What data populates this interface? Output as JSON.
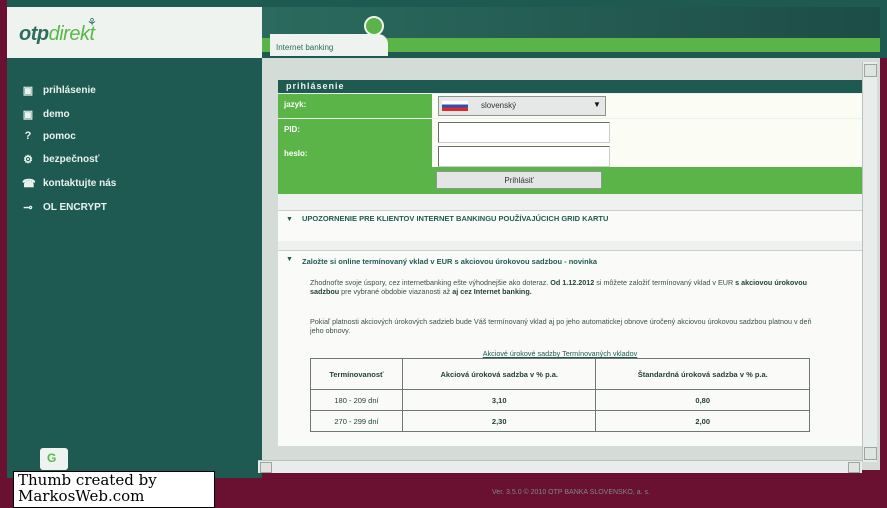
{
  "brand": {
    "logo_main": "otp",
    "logo_accent": "direkt"
  },
  "header": {
    "tab_label": "Internet banking"
  },
  "sidebar": {
    "items": [
      {
        "label": "prihlásenie",
        "icon": "square-icon"
      },
      {
        "label": "demo",
        "icon": "square-icon"
      },
      {
        "label": "pomoc",
        "icon": "question-icon"
      },
      {
        "label": "bezpečnosť",
        "icon": "gear-icon"
      },
      {
        "label": "kontaktujte nás",
        "icon": "phone-icon"
      },
      {
        "label": "OL ENCRYPT",
        "icon": "key-icon"
      }
    ]
  },
  "login": {
    "title": "prihlásenie",
    "language_label": "jazyk:",
    "language_value": "slovenský",
    "pid_label": "PID:",
    "password_label": "heslo:",
    "submit_label": "Prihlásiť"
  },
  "notice1": {
    "title": "UPOZORNENIE PRE KLIENTOV INTERNET BANKINGU POUŽÍVAJÚCICH GRID KARTU"
  },
  "notice2": {
    "title": "Založte si online termínovaný vklad v EUR s akciovou úrokovou sadzbou - novinka",
    "para1_a": "Zhodnoťte svoje úspory, cez internetbanking ešte výhodnejšie ako doteraz. ",
    "para1_b": "Od 1.12.2012",
    "para1_c": " si môžete založiť termínovaný vklad v EUR ",
    "para1_d": "s akciovou úrokovou sadzbou",
    "para1_e": " pre vybrané obdobie viazanosti až ",
    "para1_f": "aj cez Internet banking.",
    "para2": "Pokiaľ platnosti akciových úrokových sadzieb bude Váš termínovaný vklad aj po jeho automatickej obnove úročený akciovou úrokovou sadzbou platnou v deň jeho obnovy.",
    "table_caption": "Akciové úrokové sadzby Termínovaných vkladov",
    "headers": [
      "Termínovanosť",
      "Akciová úroková sadzba v % p.a.",
      "Štandardná úroková sadzba v % p.a."
    ],
    "rows": [
      [
        "180 - 209 dní",
        "3,10",
        "0,80"
      ],
      [
        "270 - 299 dní",
        "2,30",
        "2,00"
      ]
    ]
  },
  "footer": {
    "text": "Ver. 3.5.0 © 2010 OTP BANKA SLOVENSKO, a. s."
  },
  "watermark": {
    "line1": "Thumb created by",
    "line2": "MarkosWeb.com"
  }
}
